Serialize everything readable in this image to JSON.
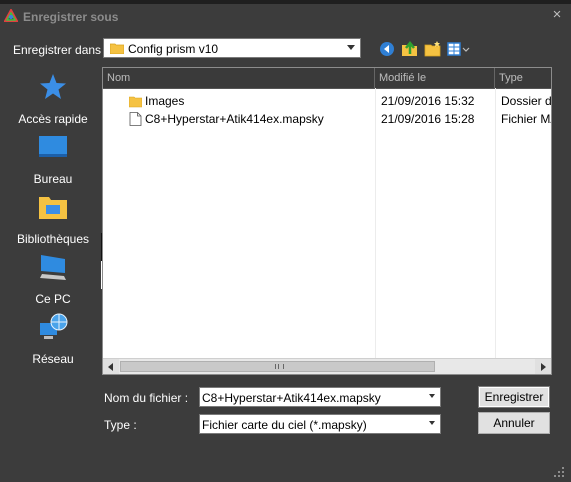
{
  "window": {
    "title": "Enregistrer sous",
    "close_glyph": "×"
  },
  "toolbar": {
    "save_in_label": "Enregistrer dans :",
    "current_folder": "Config prism v10",
    "icons": [
      "back-icon",
      "up-folder-icon",
      "new-folder-icon",
      "view-menu-icon"
    ]
  },
  "places": [
    {
      "label": "Accès rapide",
      "icon": "star-icon"
    },
    {
      "label": "Bureau",
      "icon": "desktop-icon"
    },
    {
      "label": "Bibliothèques",
      "icon": "libraries-icon"
    },
    {
      "label": "Ce PC",
      "icon": "computer-icon"
    },
    {
      "label": "Réseau",
      "icon": "network-icon"
    }
  ],
  "filelist": {
    "columns": [
      "Nom",
      "Modifié le",
      "Type"
    ],
    "rows": [
      {
        "name": "Images",
        "modified": "21/09/2016 15:32",
        "type": "Dossier de",
        "icon": "folder-icon"
      },
      {
        "name": "C8+Hyperstar+Atik414ex.mapsky",
        "modified": "21/09/2016 15:28",
        "type": "Fichier MA",
        "icon": "file-icon"
      }
    ]
  },
  "form": {
    "filename_label": "Nom du fichier :",
    "filename_value": "C8+Hyperstar+Atik414ex.mapsky",
    "type_label": "Type :",
    "type_value": "Fichier carte du ciel (*.mapsky)",
    "save_button": "Enregistrer",
    "cancel_button": "Annuler"
  },
  "colors": {
    "background": "#3c3c3c",
    "accent": "#2f8be0",
    "folder": "#f5c242"
  }
}
